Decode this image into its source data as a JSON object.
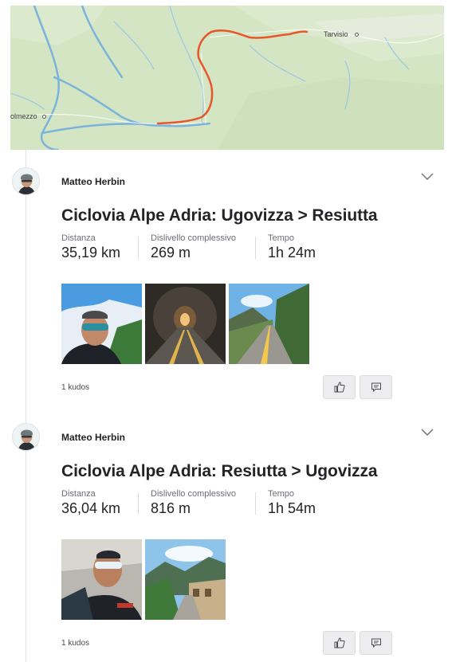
{
  "map": {
    "labels": {
      "tarvisio": "Tarvisio",
      "tolmezzo": "olmezzo"
    },
    "route_color": "#e8572a",
    "river_color": "#7bb3dd",
    "land_color": "#d4e5c3"
  },
  "activities": [
    {
      "athlete": "Matteo Herbin",
      "title": "Ciclovia Alpe Adria: Ugovizza > Resiutta",
      "stats": [
        {
          "label": "Distanza",
          "value": "35,19 km"
        },
        {
          "label": "Dislivello complessivo",
          "value": "269 m"
        },
        {
          "label": "Tempo",
          "value": "1h 24m"
        }
      ],
      "photos": [
        "selfie-sunglasses",
        "bike-tunnel",
        "cycle-path-valley"
      ],
      "kudos": "1 kudos"
    },
    {
      "athlete": "Matteo Herbin",
      "title": "Ciclovia Alpe Adria: Resiutta > Ugovizza",
      "stats": [
        {
          "label": "Distanza",
          "value": "36,04 km"
        },
        {
          "label": "Dislivello complessivo",
          "value": "816 m"
        },
        {
          "label": "Tempo",
          "value": "1h 54m"
        }
      ],
      "photos": [
        "selfie-riding",
        "mountain-station"
      ],
      "kudos": "1 kudos"
    }
  ],
  "icons": {
    "expand": "chevron-down-icon",
    "kudos": "thumbs-up-icon",
    "comment": "comment-icon"
  }
}
